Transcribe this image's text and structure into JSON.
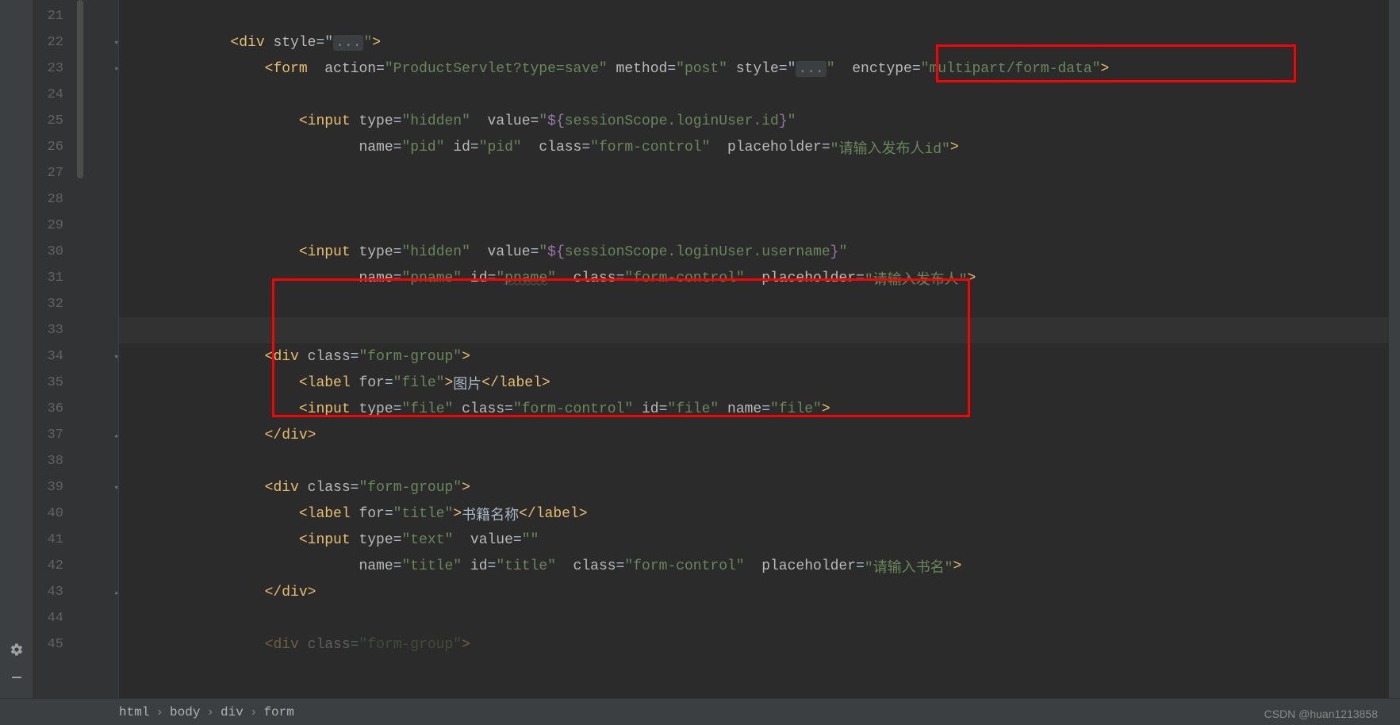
{
  "lines": {
    "start": 21,
    "end": 45
  },
  "code": {
    "l22": {
      "indent": "        ",
      "open": "<",
      "tag": "div ",
      "a1": "style",
      "eq": "=\"",
      "fold": "...",
      "close_q": "\"",
      "end": ">"
    },
    "l23": {
      "indent": "            ",
      "open": "<",
      "tag": "form  ",
      "a1": "action",
      "v1": "\"ProductServlet?type=save\" ",
      "a2": "method",
      "v2": "\"post\" ",
      "a3": "style",
      "fold": "...",
      "q": "\"",
      "sp": "  ",
      "a4": "enctype",
      "v4": "\"multipart/form-data\"",
      "end": ">"
    },
    "l25": {
      "indent": "                ",
      "open": "<",
      "tag": "input ",
      "a1": "type",
      "v1": "\"hidden\"  ",
      "a2": "value",
      "v2_open": "\"",
      "expr": "${",
      "expr_in": "sessionScope.loginUser.id",
      "expr_close": "}",
      "v2_close": "\""
    },
    "l26": {
      "indent": "                       ",
      "a1": "name",
      "v1": "\"pid\" ",
      "a2": "id",
      "v2": "\"pid\"  ",
      "a3": "class",
      "v3": "\"form-control\"  ",
      "a4": "placeholder",
      "v4": "\"请输入发布人id\"",
      "end": ">"
    },
    "l30": {
      "indent": "                ",
      "open": "<",
      "tag": "input ",
      "a1": "type",
      "v1": "\"hidden\"  ",
      "a2": "value",
      "v2_open": "\"",
      "expr": "${",
      "expr_in": "sessionScope.loginUser.username",
      "expr_close": "}",
      "v2_close": "\""
    },
    "l31": {
      "indent": "                       ",
      "a1": "name",
      "v1": "\"pname\" ",
      "a2": "id",
      "v2": "\"",
      "v2in": "pname",
      "v2c": "\"  ",
      "a3": "class",
      "v3": "\"form-control\"  ",
      "a4": "placeholder",
      "v4": "\"请输入发布人\"",
      "end": ">"
    },
    "l34": {
      "indent": "            ",
      "open": "<",
      "tag": "div ",
      "a1": "class",
      "v1": "\"form-group\"",
      "end": ">"
    },
    "l35": {
      "indent": "                ",
      "open": "<",
      "tag": "label ",
      "a1": "for",
      "v1": "\"file\"",
      "mid": ">",
      "text": "图片",
      "close": "</",
      "ctag": "label",
      "cend": ">"
    },
    "l36": {
      "indent": "                ",
      "open": "<",
      "tag": "input ",
      "a1": "type",
      "v1": "\"file\" ",
      "a2": "class",
      "v2": "\"form-control\" ",
      "a3": "id",
      "v3": "\"file\" ",
      "a4": "name",
      "v4": "\"file\"",
      "end": ">"
    },
    "l37": {
      "indent": "            ",
      "open": "</",
      "tag": "div",
      "end": ">"
    },
    "l39": {
      "indent": "            ",
      "open": "<",
      "tag": "div ",
      "a1": "class",
      "v1": "\"form-group\"",
      "end": ">"
    },
    "l40": {
      "indent": "                ",
      "open": "<",
      "tag": "label ",
      "a1": "for",
      "v1": "\"title\"",
      "mid": ">",
      "text": "书籍名称",
      "close": "</",
      "ctag": "label",
      "cend": ">"
    },
    "l41": {
      "indent": "                ",
      "open": "<",
      "tag": "input ",
      "a1": "type",
      "v1": "\"text\"  ",
      "a2": "value",
      "v2": "\"\""
    },
    "l42": {
      "indent": "                       ",
      "a1": "name",
      "v1": "\"title\" ",
      "a2": "id",
      "v2": "\"title\"  ",
      "a3": "class",
      "v3": "\"form-control\"  ",
      "a4": "placeholder",
      "v4": "\"请输入书名\"",
      "end": ">"
    },
    "l43": {
      "indent": "            ",
      "open": "</",
      "tag": "div",
      "end": ">"
    },
    "l45": {
      "indent": "            ",
      "open": "<",
      "tag": "div ",
      "a1": "class",
      "v1": "\"form-group\"",
      "end": ">"
    }
  },
  "breadcrumb": [
    "html",
    "body",
    "div",
    "form"
  ],
  "watermark": "CSDN @huan1213858"
}
